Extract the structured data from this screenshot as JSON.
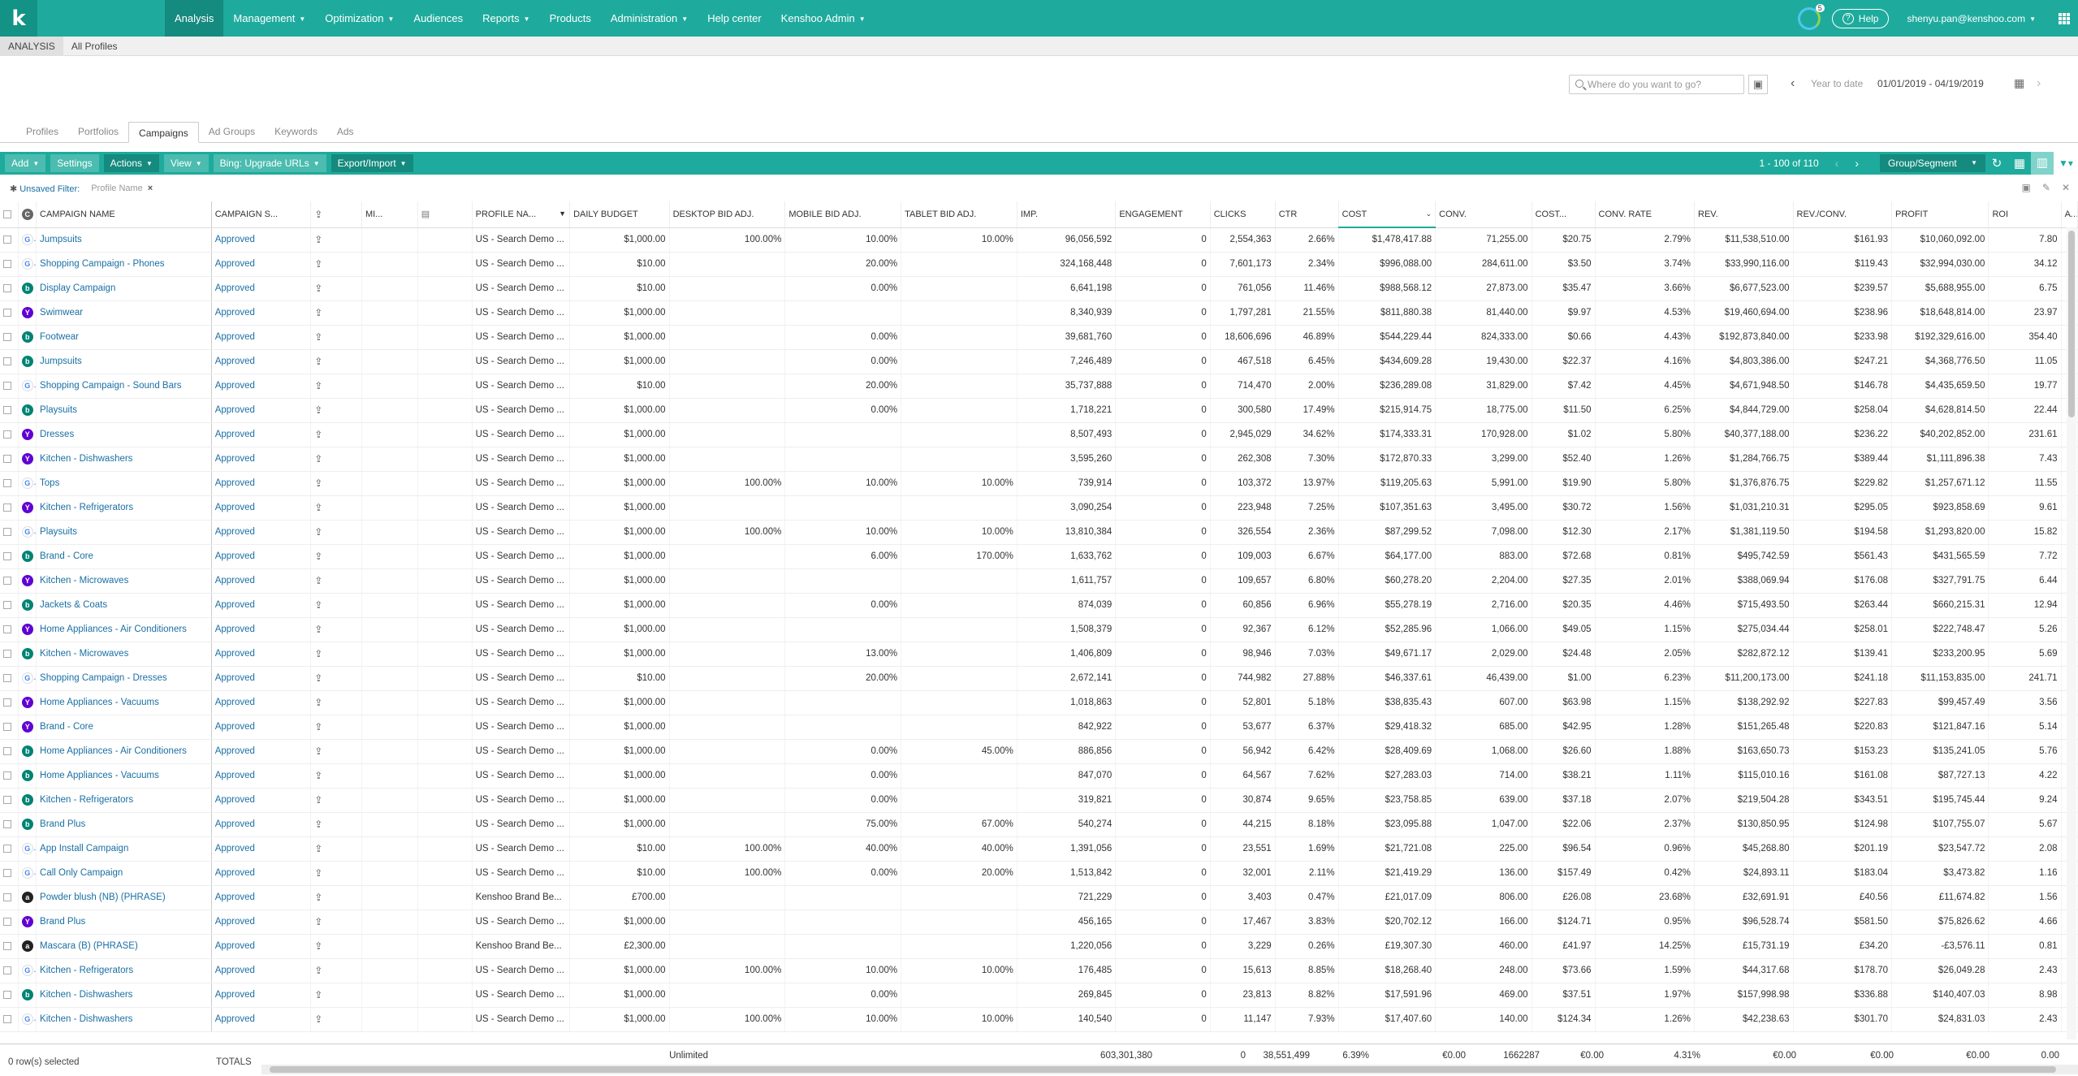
{
  "nav": {
    "logo": "k",
    "items": [
      {
        "label": "Analysis",
        "caret": false,
        "active": true
      },
      {
        "label": "Management",
        "caret": true
      },
      {
        "label": "Optimization",
        "caret": true
      },
      {
        "label": "Audiences",
        "caret": false
      },
      {
        "label": "Reports",
        "caret": true
      },
      {
        "label": "Products",
        "caret": false
      },
      {
        "label": "Administration",
        "caret": true
      },
      {
        "label": "Help center",
        "caret": false
      },
      {
        "label": "Kenshoo Admin",
        "caret": true
      }
    ],
    "notification_count": "5",
    "help_label": "Help",
    "user_email": "shenyu.pan@kenshoo.com"
  },
  "subbar": {
    "section": "ANALYSIS",
    "profiles": "All Profiles"
  },
  "search": {
    "placeholder": "Where do you want to go?"
  },
  "date": {
    "label": "Year to date",
    "range": "01/01/2019 - 04/19/2019"
  },
  "entity_tabs": [
    {
      "label": "Profiles"
    },
    {
      "label": "Portfolios"
    },
    {
      "label": "Campaigns",
      "active": true
    },
    {
      "label": "Ad Groups"
    },
    {
      "label": "Keywords"
    },
    {
      "label": "Ads"
    }
  ],
  "toolbar": {
    "add": "Add",
    "settings": "Settings",
    "actions": "Actions",
    "view": "View",
    "bing": "Bing: Upgrade URLs",
    "export": "Export/Import",
    "pager": "1 - 100 of 110",
    "group": "Group/Segment"
  },
  "filter": {
    "unsaved": "Unsaved Filter:",
    "chip": "Profile Name"
  },
  "columns": [
    "CAMPAIGN NAME",
    "CAMPAIGN S...",
    "MI...",
    "PROFILE NA...",
    "DAILY BUDGET",
    "DESKTOP BID ADJ.",
    "MOBILE BID ADJ.",
    "TABLET BID ADJ.",
    "IMP.",
    "ENGAGEMENT",
    "CLICKS",
    "CTR",
    "COST",
    "CONV.",
    "COST...",
    "CONV. RATE",
    "REV.",
    "REV./CONV.",
    "PROFIT",
    "ROI",
    "AV"
  ],
  "rows": [
    [
      "g",
      "Jumpsuits",
      "Approved",
      "US - Search Demo ...",
      "$1,000.00",
      "100.00%",
      "10.00%",
      "10.00%",
      "96,056,592",
      "0",
      "2,554,363",
      "2.66%",
      "$1,478,417.88",
      "71,255.00",
      "$20.75",
      "2.79%",
      "$11,538,510.00",
      "$161.93",
      "$10,060,092.00",
      "7.80"
    ],
    [
      "g",
      "Shopping Campaign - Phones",
      "Approved",
      "US - Search Demo ...",
      "$10.00",
      "",
      "20.00%",
      "",
      "324,168,448",
      "0",
      "7,601,173",
      "2.34%",
      "$996,088.00",
      "284,611.00",
      "$3.50",
      "3.74%",
      "$33,990,116.00",
      "$119.43",
      "$32,994,030.00",
      "34.12"
    ],
    [
      "b",
      "Display Campaign",
      "Approved",
      "US - Search Demo ...",
      "$10.00",
      "",
      "0.00%",
      "",
      "6,641,198",
      "0",
      "761,056",
      "11.46%",
      "$988,568.12",
      "27,873.00",
      "$35.47",
      "3.66%",
      "$6,677,523.00",
      "$239.57",
      "$5,688,955.00",
      "6.75"
    ],
    [
      "y",
      "Swimwear",
      "Approved",
      "US - Search Demo ...",
      "$1,000.00",
      "",
      "",
      "",
      "8,340,939",
      "0",
      "1,797,281",
      "21.55%",
      "$811,880.38",
      "81,440.00",
      "$9.97",
      "4.53%",
      "$19,460,694.00",
      "$238.96",
      "$18,648,814.00",
      "23.97"
    ],
    [
      "b",
      "Footwear",
      "Approved",
      "US - Search Demo ...",
      "$1,000.00",
      "",
      "0.00%",
      "",
      "39,681,760",
      "0",
      "18,606,696",
      "46.89%",
      "$544,229.44",
      "824,333.00",
      "$0.66",
      "4.43%",
      "$192,873,840.00",
      "$233.98",
      "$192,329,616.00",
      "354.40"
    ],
    [
      "b",
      "Jumpsuits",
      "Approved",
      "US - Search Demo ...",
      "$1,000.00",
      "",
      "0.00%",
      "",
      "7,246,489",
      "0",
      "467,518",
      "6.45%",
      "$434,609.28",
      "19,430.00",
      "$22.37",
      "4.16%",
      "$4,803,386.00",
      "$247.21",
      "$4,368,776.50",
      "11.05"
    ],
    [
      "g",
      "Shopping Campaign - Sound Bars",
      "Approved",
      "US - Search Demo ...",
      "$10.00",
      "",
      "20.00%",
      "",
      "35,737,888",
      "0",
      "714,470",
      "2.00%",
      "$236,289.08",
      "31,829.00",
      "$7.42",
      "4.45%",
      "$4,671,948.50",
      "$146.78",
      "$4,435,659.50",
      "19.77"
    ],
    [
      "b",
      "Playsuits",
      "Approved",
      "US - Search Demo ...",
      "$1,000.00",
      "",
      "0.00%",
      "",
      "1,718,221",
      "0",
      "300,580",
      "17.49%",
      "$215,914.75",
      "18,775.00",
      "$11.50",
      "6.25%",
      "$4,844,729.00",
      "$258.04",
      "$4,628,814.50",
      "22.44"
    ],
    [
      "y",
      "Dresses",
      "Approved",
      "US - Search Demo ...",
      "$1,000.00",
      "",
      "",
      "",
      "8,507,493",
      "0",
      "2,945,029",
      "34.62%",
      "$174,333.31",
      "170,928.00",
      "$1.02",
      "5.80%",
      "$40,377,188.00",
      "$236.22",
      "$40,202,852.00",
      "231.61"
    ],
    [
      "y",
      "Kitchen - Dishwashers",
      "Approved",
      "US - Search Demo ...",
      "$1,000.00",
      "",
      "",
      "",
      "3,595,260",
      "0",
      "262,308",
      "7.30%",
      "$172,870.33",
      "3,299.00",
      "$52.40",
      "1.26%",
      "$1,284,766.75",
      "$389.44",
      "$1,111,896.38",
      "7.43"
    ],
    [
      "g",
      "Tops",
      "Approved",
      "US - Search Demo ...",
      "$1,000.00",
      "100.00%",
      "10.00%",
      "10.00%",
      "739,914",
      "0",
      "103,372",
      "13.97%",
      "$119,205.63",
      "5,991.00",
      "$19.90",
      "5.80%",
      "$1,376,876.75",
      "$229.82",
      "$1,257,671.12",
      "11.55"
    ],
    [
      "y",
      "Kitchen - Refrigerators",
      "Approved",
      "US - Search Demo ...",
      "$1,000.00",
      "",
      "",
      "",
      "3,090,254",
      "0",
      "223,948",
      "7.25%",
      "$107,351.63",
      "3,495.00",
      "$30.72",
      "1.56%",
      "$1,031,210.31",
      "$295.05",
      "$923,858.69",
      "9.61"
    ],
    [
      "g",
      "Playsuits",
      "Approved",
      "US - Search Demo ...",
      "$1,000.00",
      "100.00%",
      "10.00%",
      "10.00%",
      "13,810,384",
      "0",
      "326,554",
      "2.36%",
      "$87,299.52",
      "7,098.00",
      "$12.30",
      "2.17%",
      "$1,381,119.50",
      "$194.58",
      "$1,293,820.00",
      "15.82"
    ],
    [
      "b",
      "Brand - Core",
      "Approved",
      "US - Search Demo ...",
      "$1,000.00",
      "",
      "6.00%",
      "170.00%",
      "1,633,762",
      "0",
      "109,003",
      "6.67%",
      "$64,177.00",
      "883.00",
      "$72.68",
      "0.81%",
      "$495,742.59",
      "$561.43",
      "$431,565.59",
      "7.72"
    ],
    [
      "y",
      "Kitchen - Microwaves",
      "Approved",
      "US - Search Demo ...",
      "$1,000.00",
      "",
      "",
      "",
      "1,611,757",
      "0",
      "109,657",
      "6.80%",
      "$60,278.20",
      "2,204.00",
      "$27.35",
      "2.01%",
      "$388,069.94",
      "$176.08",
      "$327,791.75",
      "6.44"
    ],
    [
      "b",
      "Jackets & Coats",
      "Approved",
      "US - Search Demo ...",
      "$1,000.00",
      "",
      "0.00%",
      "",
      "874,039",
      "0",
      "60,856",
      "6.96%",
      "$55,278.19",
      "2,716.00",
      "$20.35",
      "4.46%",
      "$715,493.50",
      "$263.44",
      "$660,215.31",
      "12.94"
    ],
    [
      "y",
      "Home Appliances - Air Conditioners",
      "Approved",
      "US - Search Demo ...",
      "$1,000.00",
      "",
      "",
      "",
      "1,508,379",
      "0",
      "92,367",
      "6.12%",
      "$52,285.96",
      "1,066.00",
      "$49.05",
      "1.15%",
      "$275,034.44",
      "$258.01",
      "$222,748.47",
      "5.26"
    ],
    [
      "b",
      "Kitchen - Microwaves",
      "Approved",
      "US - Search Demo ...",
      "$1,000.00",
      "",
      "13.00%",
      "",
      "1,406,809",
      "0",
      "98,946",
      "7.03%",
      "$49,671.17",
      "2,029.00",
      "$24.48",
      "2.05%",
      "$282,872.12",
      "$139.41",
      "$233,200.95",
      "5.69"
    ],
    [
      "g",
      "Shopping Campaign - Dresses",
      "Approved",
      "US - Search Demo ...",
      "$10.00",
      "",
      "20.00%",
      "",
      "2,672,141",
      "0",
      "744,982",
      "27.88%",
      "$46,337.61",
      "46,439.00",
      "$1.00",
      "6.23%",
      "$11,200,173.00",
      "$241.18",
      "$11,153,835.00",
      "241.71"
    ],
    [
      "y",
      "Home Appliances - Vacuums",
      "Approved",
      "US - Search Demo ...",
      "$1,000.00",
      "",
      "",
      "",
      "1,018,863",
      "0",
      "52,801",
      "5.18%",
      "$38,835.43",
      "607.00",
      "$63.98",
      "1.15%",
      "$138,292.92",
      "$227.83",
      "$99,457.49",
      "3.56"
    ],
    [
      "y",
      "Brand - Core",
      "Approved",
      "US - Search Demo ...",
      "$1,000.00",
      "",
      "",
      "",
      "842,922",
      "0",
      "53,677",
      "6.37%",
      "$29,418.32",
      "685.00",
      "$42.95",
      "1.28%",
      "$151,265.48",
      "$220.83",
      "$121,847.16",
      "5.14"
    ],
    [
      "b",
      "Home Appliances - Air Conditioners",
      "Approved",
      "US - Search Demo ...",
      "$1,000.00",
      "",
      "0.00%",
      "45.00%",
      "886,856",
      "0",
      "56,942",
      "6.42%",
      "$28,409.69",
      "1,068.00",
      "$26.60",
      "1.88%",
      "$163,650.73",
      "$153.23",
      "$135,241.05",
      "5.76"
    ],
    [
      "b",
      "Home Appliances - Vacuums",
      "Approved",
      "US - Search Demo ...",
      "$1,000.00",
      "",
      "0.00%",
      "",
      "847,070",
      "0",
      "64,567",
      "7.62%",
      "$27,283.03",
      "714.00",
      "$38.21",
      "1.11%",
      "$115,010.16",
      "$161.08",
      "$87,727.13",
      "4.22"
    ],
    [
      "b",
      "Kitchen - Refrigerators",
      "Approved",
      "US - Search Demo ...",
      "$1,000.00",
      "",
      "0.00%",
      "",
      "319,821",
      "0",
      "30,874",
      "9.65%",
      "$23,758.85",
      "639.00",
      "$37.18",
      "2.07%",
      "$219,504.28",
      "$343.51",
      "$195,745.44",
      "9.24"
    ],
    [
      "b",
      "Brand Plus",
      "Approved",
      "US - Search Demo ...",
      "$1,000.00",
      "",
      "75.00%",
      "67.00%",
      "540,274",
      "0",
      "44,215",
      "8.18%",
      "$23,095.88",
      "1,047.00",
      "$22.06",
      "2.37%",
      "$130,850.95",
      "$124.98",
      "$107,755.07",
      "5.67"
    ],
    [
      "g",
      "App Install Campaign",
      "Approved",
      "US - Search Demo ...",
      "$10.00",
      "100.00%",
      "40.00%",
      "40.00%",
      "1,391,056",
      "0",
      "23,551",
      "1.69%",
      "$21,721.08",
      "225.00",
      "$96.54",
      "0.96%",
      "$45,268.80",
      "$201.19",
      "$23,547.72",
      "2.08"
    ],
    [
      "g",
      "Call Only Campaign",
      "Approved",
      "US - Search Demo ...",
      "$10.00",
      "100.00%",
      "0.00%",
      "20.00%",
      "1,513,842",
      "0",
      "32,001",
      "2.11%",
      "$21,419.29",
      "136.00",
      "$157.49",
      "0.42%",
      "$24,893.11",
      "$183.04",
      "$3,473.82",
      "1.16"
    ],
    [
      "a",
      "Powder blush (NB) (PHRASE)",
      "Approved",
      "Kenshoo Brand Be...",
      "£700.00",
      "",
      "",
      "",
      "721,229",
      "0",
      "3,403",
      "0.47%",
      "£21,017.09",
      "806.00",
      "£26.08",
      "23.68%",
      "£32,691.91",
      "£40.56",
      "£11,674.82",
      "1.56"
    ],
    [
      "y",
      "Brand Plus",
      "Approved",
      "US - Search Demo ...",
      "$1,000.00",
      "",
      "",
      "",
      "456,165",
      "0",
      "17,467",
      "3.83%",
      "$20,702.12",
      "166.00",
      "$124.71",
      "0.95%",
      "$96,528.74",
      "$581.50",
      "$75,826.62",
      "4.66"
    ],
    [
      "a",
      "Mascara (B) (PHRASE)",
      "Approved",
      "Kenshoo Brand Be...",
      "£2,300.00",
      "",
      "",
      "",
      "1,220,056",
      "0",
      "3,229",
      "0.26%",
      "£19,307.30",
      "460.00",
      "£41.97",
      "14.25%",
      "£15,731.19",
      "£34.20",
      "-£3,576.11",
      "0.81"
    ],
    [
      "g",
      "Kitchen - Refrigerators",
      "Approved",
      "US - Search Demo ...",
      "$1,000.00",
      "100.00%",
      "10.00%",
      "10.00%",
      "176,485",
      "0",
      "15,613",
      "8.85%",
      "$18,268.40",
      "248.00",
      "$73.66",
      "1.59%",
      "$44,317.68",
      "$178.70",
      "$26,049.28",
      "2.43"
    ],
    [
      "b",
      "Kitchen - Dishwashers",
      "Approved",
      "US - Search Demo ...",
      "$1,000.00",
      "",
      "0.00%",
      "",
      "269,845",
      "0",
      "23,813",
      "8.82%",
      "$17,591.96",
      "469.00",
      "$37.51",
      "1.97%",
      "$157,998.98",
      "$336.88",
      "$140,407.03",
      "8.98"
    ],
    [
      "g",
      "Kitchen - Dishwashers",
      "Approved",
      "US - Search Demo ...",
      "$1,000.00",
      "100.00%",
      "10.00%",
      "10.00%",
      "140,540",
      "0",
      "11,147",
      "7.93%",
      "$17,407.60",
      "140.00",
      "$124.34",
      "1.26%",
      "$42,238.63",
      "$301.70",
      "$24,831.03",
      "2.43"
    ]
  ],
  "footer": {
    "selected": "0 row(s) selected",
    "totals_label": "TOTALS",
    "totals": [
      "Unlimited",
      "603,301,380",
      "0",
      "38,551,499",
      "6.39%",
      "€0.00",
      "1662287",
      "€0.00",
      "4.31%",
      "€0.00",
      "€0.00",
      "€0.00",
      "0.00"
    ]
  }
}
